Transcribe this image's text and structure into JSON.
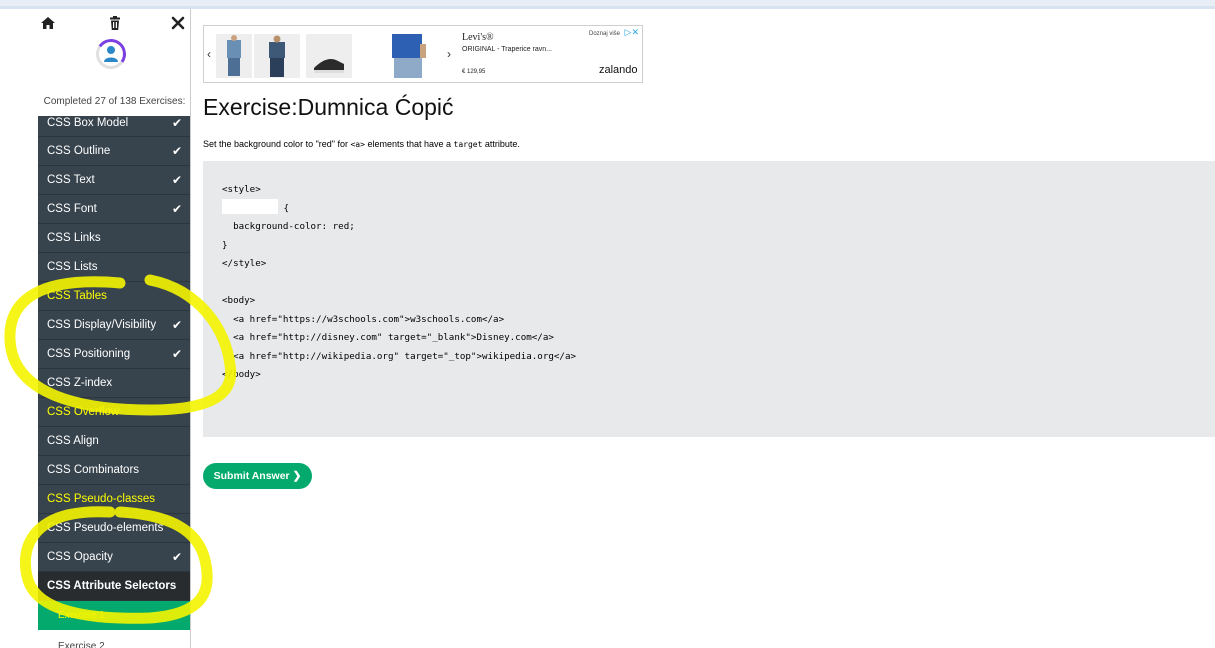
{
  "sidebar": {
    "completed_text": "Completed 27 of 138 Exercises:",
    "items": [
      {
        "label": "CSS Box Model",
        "checked": true
      },
      {
        "label": "CSS Outline",
        "checked": true
      },
      {
        "label": "CSS Text",
        "checked": true
      },
      {
        "label": "CSS Font",
        "checked": true
      },
      {
        "label": "CSS Links",
        "checked": false
      },
      {
        "label": "CSS Lists",
        "checked": false
      },
      {
        "label": "CSS Tables",
        "checked": false
      },
      {
        "label": "CSS Display/Visibility",
        "checked": true
      },
      {
        "label": "CSS Positioning",
        "checked": true
      },
      {
        "label": "CSS Z-index",
        "checked": false
      },
      {
        "label": "CSS Overflow",
        "checked": false
      },
      {
        "label": "CSS Align",
        "checked": false
      },
      {
        "label": "CSS Combinators",
        "checked": false
      },
      {
        "label": "CSS Pseudo-classes",
        "checked": false
      },
      {
        "label": "CSS Pseudo-elements",
        "checked": false
      },
      {
        "label": "CSS Opacity",
        "checked": true
      },
      {
        "label": "CSS Attribute Selectors",
        "checked": false
      }
    ],
    "subitems": [
      "Exercise 1",
      "Exercise 2"
    ],
    "checkmark": "✔",
    "progress_fraction": 0.196
  },
  "ad": {
    "brand": "Levi's®",
    "product": "ORIGINAL - Traperice ravn...",
    "price": "€ 129,95",
    "cta": "Doznaj više",
    "shop": "zalando"
  },
  "exercise": {
    "title": "Exercise:Dumnica Ćopić",
    "instruction_pre": "Set the background color to \"red\" for ",
    "instruction_code1": "<a>",
    "instruction_mid": " elements that have a ",
    "instruction_code2": "target",
    "instruction_post": " attribute."
  },
  "code": {
    "l1": "<style>",
    "l2_after": " {",
    "l3": "  background-color: red;",
    "l4": "}",
    "l5": "</style>",
    "l6": "",
    "l7": "<body>",
    "l8": "  <a href=\"https://w3schools.com\">w3schools.com</a>",
    "l9": "  <a href=\"http://disney.com\" target=\"_blank\">Disney.com</a>",
    "l10": "  <a href=\"http://wikipedia.org\" target=\"_top\">wikipedia.org</a>",
    "l11": "</body>"
  },
  "submit_label": "Submit Answer ❯",
  "colors": {
    "sidebar_bg": "#38444d",
    "accent_green": "#04aa6d",
    "highlight_yellow": "#ffff00",
    "editor_bg": "#e7e9eb"
  }
}
